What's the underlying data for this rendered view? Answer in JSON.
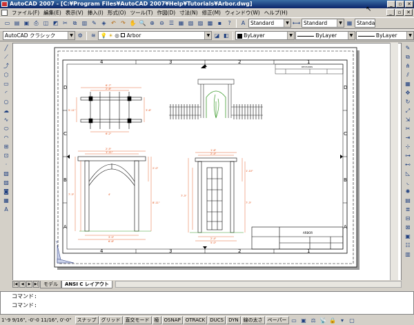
{
  "window": {
    "title": "AutoCAD 2007 - [C:¥Program Files¥AutoCAD 2007¥Help¥Tutorials¥Arbor.dwg]"
  },
  "menu": [
    "ファイル(F)",
    "編集(E)",
    "表示(V)",
    "挿入(I)",
    "形式(O)",
    "ツール(T)",
    "作図(D)",
    "寸法(N)",
    "修正(M)",
    "ウィンドウ(W)",
    "ヘルプ(H)"
  ],
  "styles": {
    "text_style": "Standard",
    "dim_style": "Standard",
    "table_style": "Standa"
  },
  "workspace": "AutoCAD クラシック",
  "layer": "Arbor",
  "color": "ByLayer",
  "linetype": "ByLayer",
  "lineweight": "ByLayer",
  "drawing": {
    "columns_top": [
      "4",
      "3",
      "2",
      "1"
    ],
    "rows_left": [
      "D",
      "C",
      "B",
      "A"
    ],
    "dims": [
      "6'-7\"",
      "5'-11\"",
      "3'-6\"",
      "2'-6\"",
      "6'-2\"",
      "1'-11\"",
      "2'-5\"",
      "7'-3\"",
      "2'-0\"",
      "8'-11\"",
      "4'",
      "3'-5\"",
      "1'-6\"",
      "6'-8\"",
      "2'-4\"",
      "1'-10\"",
      "7'-3\"",
      "5'-0\""
    ],
    "title_block_label": "ARBOR"
  },
  "tabs": [
    "モデル",
    "ANSI C レイアウト"
  ],
  "command_prompt_1": "コマンド:",
  "command_prompt_2": "コマンド:",
  "status": {
    "coords": "1'-9 9/16\",  -0'-0 11/16\", 0'-0\"",
    "buttons": [
      "スナップ",
      "グリッド",
      "直交モード",
      "極",
      "OSNAP",
      "OTRACK",
      "DUCS",
      "DYN",
      "線の太さ",
      "ペーパー"
    ]
  }
}
